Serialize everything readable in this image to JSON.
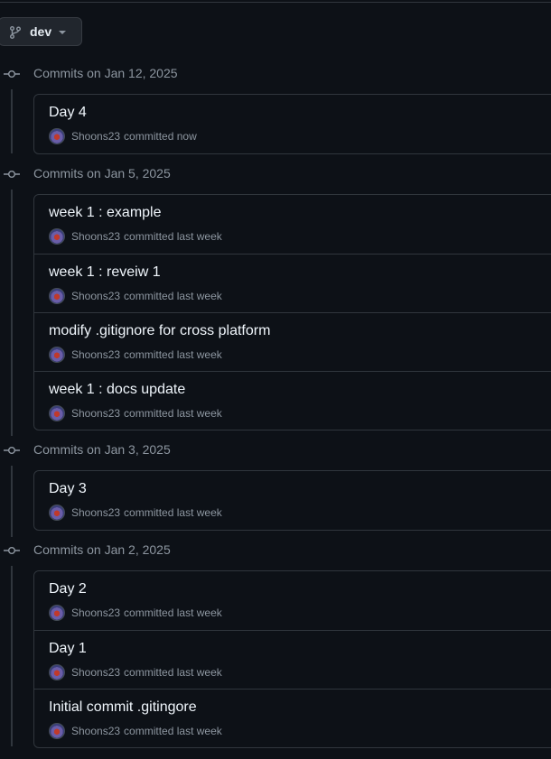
{
  "branch": {
    "name": "dev",
    "icon": "git-branch-icon"
  },
  "groups": [
    {
      "title": "Commits on Jan 12, 2025",
      "commits": [
        {
          "message": "Day 4",
          "author": "Shoons23",
          "when": "committed now"
        }
      ]
    },
    {
      "title": "Commits on Jan 5, 2025",
      "commits": [
        {
          "message": "week 1 : example",
          "author": "Shoons23",
          "when": "committed last week"
        },
        {
          "message": "week 1 : reveiw 1",
          "author": "Shoons23",
          "when": "committed last week"
        },
        {
          "message": "modify .gitignore for cross platform",
          "author": "Shoons23",
          "when": "committed last week"
        },
        {
          "message": "week 1 : docs update",
          "author": "Shoons23",
          "when": "committed last week"
        }
      ]
    },
    {
      "title": "Commits on Jan 3, 2025",
      "commits": [
        {
          "message": "Day 3",
          "author": "Shoons23",
          "when": "committed last week"
        }
      ]
    },
    {
      "title": "Commits on Jan 2, 2025",
      "commits": [
        {
          "message": "Day 2",
          "author": "Shoons23",
          "when": "committed last week"
        },
        {
          "message": "Day 1",
          "author": "Shoons23",
          "when": "committed last week"
        },
        {
          "message": "Initial commit .gitingore",
          "author": "Shoons23",
          "when": "committed last week"
        }
      ]
    }
  ],
  "colors": {
    "background": "#0d1117",
    "border": "#30363d",
    "muted": "#8d96a0",
    "text": "#f0f6fc"
  }
}
